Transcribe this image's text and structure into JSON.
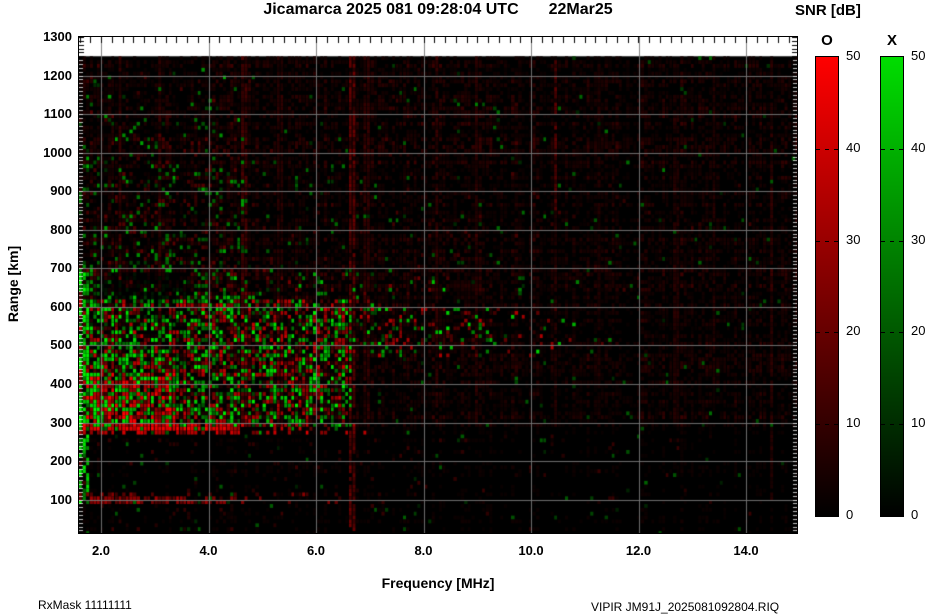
{
  "header": {
    "title_main": "Jicamarca 2025 081 09:28:04 UTC",
    "title_date": "22Mar25"
  },
  "footer": {
    "rx_mask": "RxMask 11111111",
    "file_id": "VIPIR  JM91J_2025081092804.RIQ"
  },
  "chart_data": {
    "type": "heatmap",
    "title": "Jicamarca 2025 081 09:28:04 UTC 22Mar25",
    "xlabel": "Frequency [MHz]",
    "ylabel": "Range [km]",
    "xlim": [
      1.59,
      15.0
    ],
    "ylim": [
      13,
      1300
    ],
    "x_tick_labels": [
      "2.0",
      "4.0",
      "6.0",
      "8.0",
      "10.0",
      "12.0",
      "14.0"
    ],
    "x_ticks": [
      2,
      4,
      6,
      8,
      10,
      12,
      14
    ],
    "y_tick_labels": [
      "1300",
      "1200",
      "1100",
      "1000",
      "900",
      "800",
      "700",
      "600",
      "500",
      "400",
      "300",
      "200",
      "100"
    ],
    "y_ticks": [
      1300,
      1200,
      1100,
      1000,
      900,
      800,
      700,
      600,
      500,
      400,
      300,
      200,
      100
    ],
    "minor_x_step_mhz": 0.2,
    "minor_y_step_km": 10,
    "data_top_km": 1250,
    "grid": true,
    "grid_color": "#787878",
    "background": "#000000",
    "no_data_color": "#ffffff",
    "colorbar": {
      "title": "SNR [dB]",
      "min": 0,
      "max": 50,
      "tick_labels": [
        "50",
        "40",
        "30",
        "20",
        "10",
        "0"
      ],
      "ticks": [
        50,
        40,
        30,
        20,
        10,
        0
      ],
      "modes": [
        {
          "label": "O",
          "color": "#ff0000"
        },
        {
          "label": "X",
          "color": "#00dd00"
        }
      ]
    },
    "seed": 1337,
    "echo_regions": [
      {
        "name": "diffuse-lowfreq-upper",
        "f0": 1.59,
        "f1": 4.8,
        "r0": 620,
        "r1": 1250,
        "pg": 0.16,
        "g0": 40,
        "g1": 170,
        "pr": 0.22,
        "c0": 25,
        "c1": 90,
        "fadeF": false,
        "fadeR": true
      },
      {
        "name": "diffuse-wide-upper",
        "f0": 1.59,
        "f1": 15,
        "r0": 620,
        "r1": 1250,
        "pg": 0.05,
        "g0": 30,
        "g1": 130,
        "pr": 0.1,
        "c0": 18,
        "c1": 70,
        "fadeF": true,
        "fadeR": true
      },
      {
        "name": "band-600-700",
        "f0": 1.59,
        "f1": 9.5,
        "r0": 595,
        "r1": 700,
        "pg": 0.22,
        "g0": 50,
        "g1": 200,
        "pr": 0.18,
        "c0": 30,
        "c1": 120,
        "fadeF": true,
        "fadeR": false
      },
      {
        "name": "main-echo",
        "f0": 1.59,
        "f1": 6.7,
        "r0": 285,
        "r1": 620,
        "pg": 0.4,
        "g0": 60,
        "g1": 240,
        "pr": 0.4,
        "c0": 40,
        "c1": 200,
        "fadeF": false,
        "fadeR": false
      },
      {
        "name": "bright-green-core",
        "f0": 1.59,
        "f1": 3.8,
        "r0": 290,
        "r1": 470,
        "pg": 0.5,
        "g0": 120,
        "g1": 255,
        "pr": 0.15,
        "c0": 40,
        "c1": 160,
        "fadeF": true,
        "fadeR": false
      },
      {
        "name": "red-blob",
        "f0": 1.75,
        "f1": 3.4,
        "r0": 300,
        "r1": 430,
        "pg": 0.12,
        "g0": 80,
        "g1": 200,
        "pr": 0.55,
        "c0": 120,
        "c1": 255,
        "fadeF": false,
        "fadeR": false
      },
      {
        "name": "left-edge-green",
        "f0": 1.59,
        "f1": 1.78,
        "r0": 90,
        "r1": 700,
        "pg": 0.6,
        "g0": 90,
        "g1": 255,
        "pr": 0.1,
        "c0": 30,
        "c1": 100,
        "fadeF": false,
        "fadeR": false
      },
      {
        "name": "echo-band-500km",
        "f0": 6.3,
        "f1": 11.0,
        "r0": 470,
        "r1": 600,
        "pg": 0.2,
        "g0": 60,
        "g1": 220,
        "pr": 0.3,
        "c0": 40,
        "c1": 180,
        "fadeF": true,
        "fadeR": false
      },
      {
        "name": "echo-band-extension",
        "f0": 10.4,
        "f1": 12.0,
        "r0": 480,
        "r1": 575,
        "pg": 0.1,
        "g0": 60,
        "g1": 180,
        "pr": 0.05,
        "c0": 30,
        "c1": 90,
        "fadeF": true,
        "fadeR": false
      },
      {
        "name": "cutoff-red-edge",
        "f0": 1.59,
        "f1": 7.4,
        "r0": 272,
        "r1": 302,
        "pg": 0.15,
        "g0": 60,
        "g1": 160,
        "pr": 0.8,
        "c0": 90,
        "c1": 230,
        "fadeF": true,
        "fadeR": false
      },
      {
        "name": "cutoff-red-line",
        "f0": 1.59,
        "f1": 4.6,
        "r0": 278,
        "r1": 294,
        "pg": 0.1,
        "g0": 60,
        "g1": 140,
        "pr": 0.95,
        "c0": 140,
        "c1": 255,
        "fadeF": false,
        "fadeR": false
      },
      {
        "name": "below-cutoff-sparse",
        "f0": 1.59,
        "f1": 15,
        "r0": 20,
        "r1": 272,
        "pg": 0.02,
        "g0": 25,
        "g1": 90,
        "pr": 0.05,
        "c0": 18,
        "c1": 60,
        "fadeF": true,
        "fadeR": false
      },
      {
        "name": "band-100km",
        "f0": 1.59,
        "f1": 7.0,
        "r0": 88,
        "r1": 118,
        "pg": 0.06,
        "g0": 40,
        "g1": 100,
        "pr": 0.5,
        "c0": 50,
        "c1": 150,
        "fadeF": true,
        "fadeR": false
      },
      {
        "name": "band-100km-core",
        "f0": 1.8,
        "f1": 4.5,
        "r0": 92,
        "r1": 112,
        "pg": 0.05,
        "g0": 40,
        "g1": 90,
        "pr": 0.6,
        "c0": 70,
        "c1": 170,
        "fadeF": false,
        "fadeR": false
      }
    ],
    "dark_regions": [
      {
        "name": "dark-wedge-650km",
        "f0": 2.0,
        "f1": 3.7,
        "r0": 615,
        "r1": 690,
        "p": 0.75
      }
    ],
    "interference_stripes": [
      {
        "mhz": 2.35,
        "w": 2,
        "amp": 45,
        "rlo": 285,
        "rhi": 1250
      },
      {
        "mhz": 3.1,
        "w": 2,
        "amp": 45,
        "rlo": 285,
        "rhi": 1250
      },
      {
        "mhz": 4.67,
        "w": 2,
        "amp": 60,
        "rlo": 285,
        "rhi": 1250
      },
      {
        "mhz": 5.35,
        "w": 1.5,
        "amp": 40,
        "rlo": 285,
        "rhi": 1250
      },
      {
        "mhz": 6.7,
        "w": 2.5,
        "amp": 85,
        "rlo": 14,
        "rhi": 1250
      },
      {
        "mhz": 6.95,
        "w": 1.5,
        "amp": 45,
        "rlo": 285,
        "rhi": 1250
      },
      {
        "mhz": 8.25,
        "w": 2,
        "amp": 50,
        "rlo": 285,
        "rhi": 1250
      },
      {
        "mhz": 9.0,
        "w": 1.5,
        "amp": 40,
        "rlo": 300,
        "rhi": 1250
      },
      {
        "mhz": 10.48,
        "w": 2,
        "amp": 75,
        "rlo": 850,
        "rhi": 1250
      },
      {
        "mhz": 10.48,
        "w": 1.5,
        "amp": 35,
        "rlo": 285,
        "rhi": 850
      },
      {
        "mhz": 11.3,
        "w": 1,
        "amp": 30,
        "rlo": 285,
        "rhi": 1250
      },
      {
        "mhz": 12.7,
        "w": 1.5,
        "amp": 35,
        "rlo": 285,
        "rhi": 1100
      },
      {
        "mhz": 13.4,
        "w": 1.5,
        "amp": 35,
        "rlo": 400,
        "rhi": 1250
      },
      {
        "mhz": 14.5,
        "w": 1.5,
        "amp": 40,
        "rlo": 100,
        "rhi": 1250
      }
    ]
  }
}
